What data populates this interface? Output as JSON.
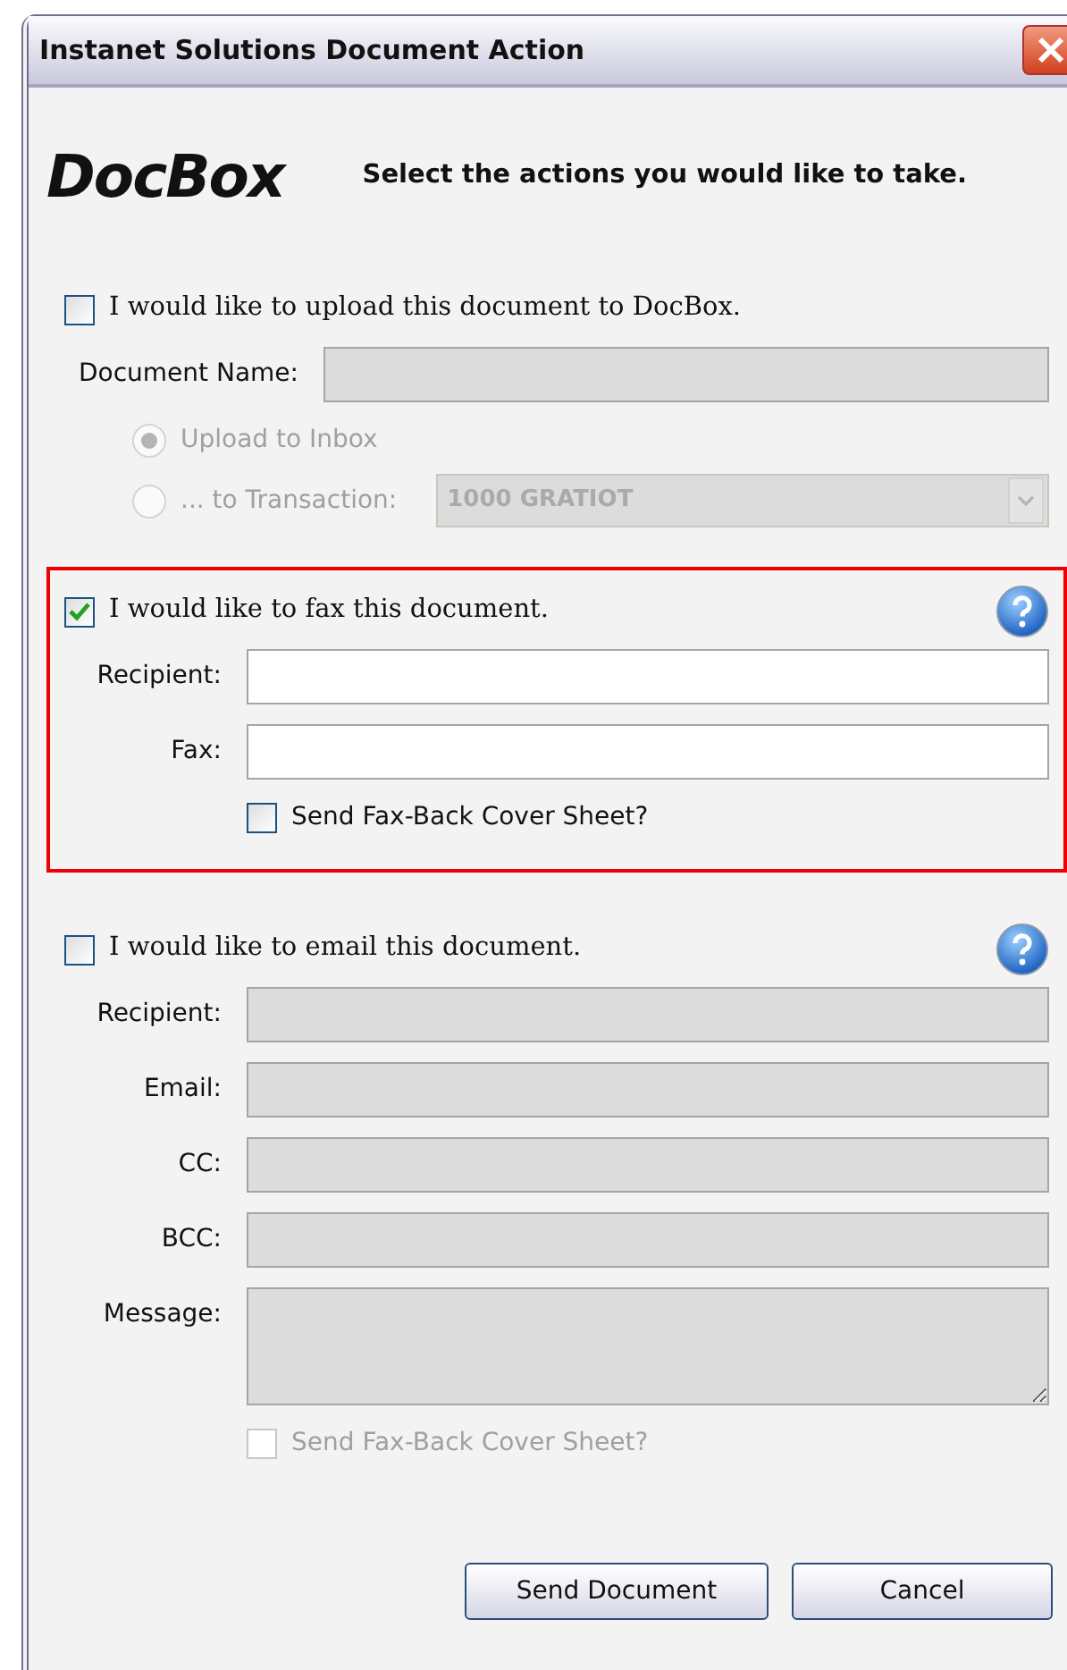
{
  "window": {
    "title": "Instanet Solutions Document Action"
  },
  "logo": {
    "text": "DocBox"
  },
  "heading": "Select the actions you would like to take.",
  "sections": [
    {
      "label": "I would like to upload this document to DocBox.",
      "checked": false,
      "highlighted": false,
      "help": false,
      "fields": [
        {
          "kind": "input",
          "label": "Document Name:",
          "disabled": true
        }
      ],
      "options": [
        {
          "kind": "radio",
          "label": "Upload to Inbox",
          "selected": true,
          "disabled": true
        },
        {
          "kind": "radio-select",
          "label": "... to Transaction:",
          "selected": false,
          "disabled": true,
          "value": "1000 GRATIOT"
        }
      ]
    },
    {
      "label": "I would like to fax this document.",
      "checked": true,
      "highlighted": true,
      "help": true,
      "fields": [
        {
          "kind": "input",
          "label": "Recipient:",
          "disabled": false
        },
        {
          "kind": "input",
          "label": "Fax:",
          "disabled": false
        }
      ],
      "options": [
        {
          "kind": "checkbox",
          "label": "Send Fax-Back Cover Sheet?",
          "checked": false,
          "disabled": false
        }
      ]
    },
    {
      "label": "I would like to email this document.",
      "checked": false,
      "highlighted": false,
      "help": true,
      "fields": [
        {
          "kind": "input",
          "label": "Recipient:",
          "disabled": true
        },
        {
          "kind": "input",
          "label": "Email:",
          "disabled": true
        },
        {
          "kind": "input",
          "label": "CC:",
          "disabled": true
        },
        {
          "kind": "input",
          "label": "BCC:",
          "disabled": true
        },
        {
          "kind": "textarea",
          "label": "Message:",
          "disabled": true
        }
      ],
      "options": [
        {
          "kind": "checkbox",
          "label": "Send Fax-Back Cover Sheet?",
          "checked": false,
          "disabled": true
        }
      ]
    }
  ],
  "buttons": [
    "Send Document",
    "Cancel"
  ]
}
